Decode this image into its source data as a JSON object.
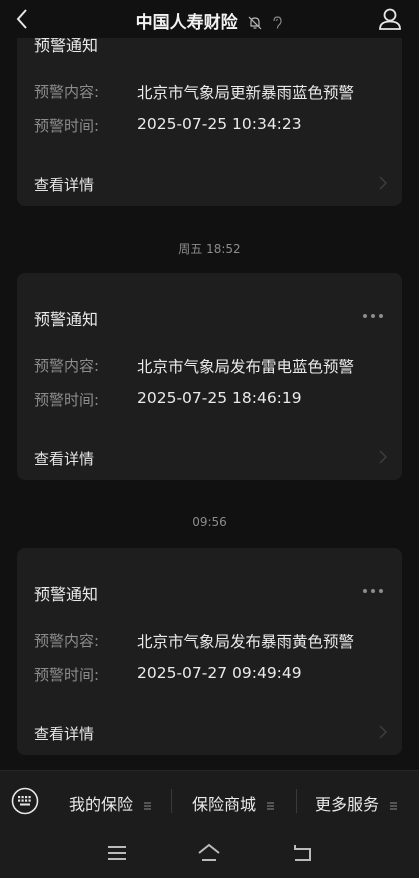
{
  "header": {
    "title": "中国人寿财险"
  },
  "messages": [
    {
      "title": "预警通知",
      "content_label": "预警内容:",
      "content_value": "北京市气象局更新暴雨蓝色预警",
      "time_label": "预警时间:",
      "time_value": "2025-07-25 10:34:23",
      "detail_label": "查看详情"
    },
    {
      "timestamp": "周五 18:52",
      "title": "预警通知",
      "content_label": "预警内容:",
      "content_value": "北京市气象局发布雷电蓝色预警",
      "time_label": "预警时间:",
      "time_value": "2025-07-25 18:46:19",
      "detail_label": "查看详情"
    },
    {
      "timestamp": "09:56",
      "title": "预警通知",
      "content_label": "预警内容:",
      "content_value": "北京市气象局发布暴雨黄色预警",
      "time_label": "预警时间:",
      "time_value": "2025-07-27 09:49:49",
      "detail_label": "查看详情"
    }
  ],
  "bottom_menu": {
    "items": [
      {
        "label": "我的保险"
      },
      {
        "label": "保险商城"
      },
      {
        "label": "更多服务"
      }
    ]
  }
}
